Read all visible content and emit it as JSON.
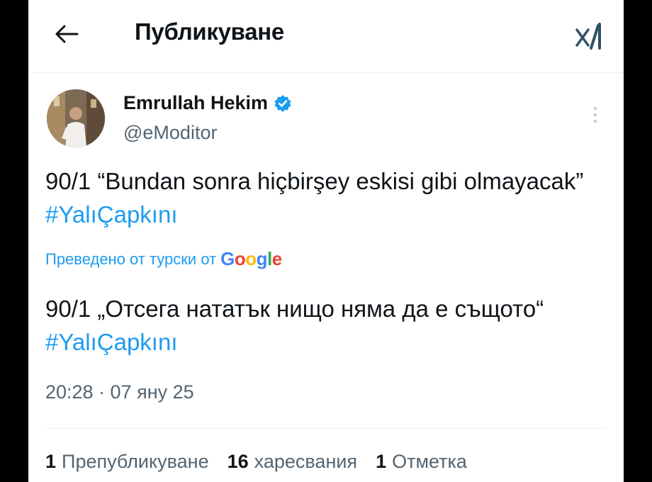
{
  "header": {
    "title": "Публикуване",
    "back_icon": "arrow-left-icon",
    "logo_icon": "x-logo-icon"
  },
  "tweet": {
    "author_name": "Emrullah Hekim",
    "author_handle": "@eModitor",
    "text_before": "90/1 “Bundan sonra hiçbirşey eskisi gibi olmayacak” ",
    "hashtag": "#YalıÇapkını",
    "translated_label": "Преведено от турски от",
    "translation_provider": "Google",
    "translation_before": "90/1 „Отсега нататък нищо няма да е същото“ ",
    "translation_hashtag": "#YalıÇapkını",
    "timestamp": "20:28 · 07 яну 25"
  },
  "stats": {
    "reposts_count": "1",
    "reposts_label": "Препубликуване",
    "likes_count": "16",
    "likes_label": "харесвания",
    "bookmarks_count": "1",
    "bookmarks_label": "Отметка"
  },
  "colors": {
    "accent": "#1d9bf0",
    "text": "#0f1419",
    "secondary": "#536471"
  }
}
